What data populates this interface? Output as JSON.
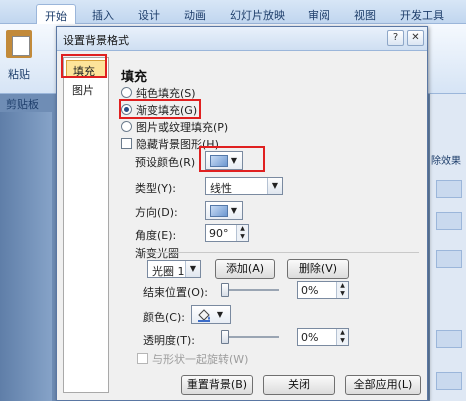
{
  "background": {
    "tabs": [
      "开始",
      "插入",
      "设计",
      "动画",
      "幻灯片放映",
      "审阅",
      "视图",
      "开发工具"
    ],
    "paste_label": "粘贴",
    "clipboard_label": "剪贴板",
    "right_label": "除效果"
  },
  "dialog": {
    "title": "设置背景格式",
    "nav": [
      {
        "label": "填充",
        "selected": true
      },
      {
        "label": "图片",
        "selected": false
      }
    ],
    "section_title": "填充",
    "fill_options": [
      {
        "label": "纯色填充(S)",
        "checked": false
      },
      {
        "label": "渐变填充(G)",
        "checked": true
      },
      {
        "label": "图片或纹理填充(P)",
        "checked": false
      }
    ],
    "hide_bg_graphics": "隐藏背景图形(H)",
    "preset_colors_label": "预设颜色(R)",
    "type_label": "类型(Y):",
    "type_value": "线性",
    "direction_label": "方向(D):",
    "angle_label": "角度(E):",
    "angle_value": "90°",
    "gradient_stops_label": "渐变光圈",
    "stop_select_value": "光圈 1",
    "add_button": "添加(A)",
    "delete_button": "删除(V)",
    "end_position_label": "结束位置(O):",
    "end_position_value": "0%",
    "color_label": "颜色(C):",
    "transparency_label": "透明度(T):",
    "transparency_value": "0%",
    "rotate_with_shape": "与形状一起旋转(W)",
    "reset_button": "重置背景(B)",
    "close_button": "关闭",
    "apply_all_button": "全部应用(L)",
    "help_button": "?",
    "close_x": "✕"
  }
}
